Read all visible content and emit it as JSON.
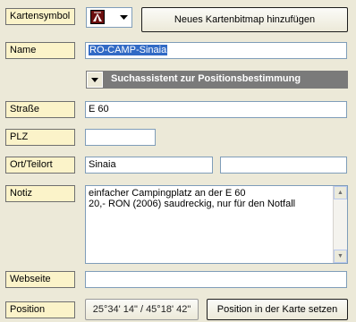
{
  "labels": {
    "kartensymbol": "Kartensymbol",
    "name": "Name",
    "strasse": "Straße",
    "plz": "PLZ",
    "ort": "Ort/Teilort",
    "notiz": "Notiz",
    "webseite": "Webseite",
    "position": "Position"
  },
  "buttons": {
    "add_bitmap": "Neues Kartenbitmap hinzufügen",
    "search_assistant": "Suchassistent zur Positionsbestimmung",
    "set_position": "Position in der Karte setzen",
    "position_value": "25°34' 14\" / 45°18' 42\""
  },
  "fields": {
    "name": "RO-CAMP-Sinaia",
    "strasse": "E 60",
    "plz": "",
    "ort": "Sinaia",
    "teilort": "",
    "notiz": "einfacher Campingplatz an der E 60\n20,- RON (2006) saudreckig, nur für den Notfall",
    "webseite": ""
  },
  "icons": {
    "map_symbol": "tent-icon",
    "dropdown": "dropdown-arrow-icon",
    "expand": "triangle-down-icon",
    "scroll_up": "scroll-up-arrow-icon",
    "scroll_down": "scroll-down-arrow-icon"
  },
  "colors": {
    "label_bg": "#fbf3c9",
    "section_bar": "#7a7a7a",
    "selection": "#316ac5",
    "window_bg": "#ece9d8"
  }
}
